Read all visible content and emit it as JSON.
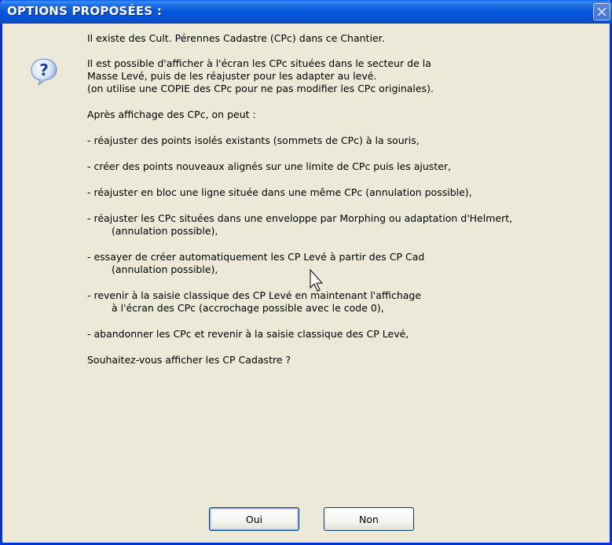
{
  "window": {
    "title": "OPTIONS PROPOSÉES :"
  },
  "icons": {
    "dialog_icon": "question-icon",
    "close": "close-icon",
    "pointer": "mouse-cursor-icon"
  },
  "message": {
    "lines": [
      "Il existe des Cult. Pérennes Cadastre (CPc) dans ce Chantier.",
      "Il est possible d'afficher à l'écran les CPc situées dans le secteur de la",
      "Masse Levé, puis de les réajuster pour les adapter au levé.",
      "(on utilise une COPIE des CPc pour ne pas modifier les CPc originales).",
      "Après affichage des CPc, on peut :",
      "- réajuster des points isolés existants (sommets de CPc) à la souris,",
      "- créer des points nouveaux alignés sur une limite de CPc puis les ajuster,",
      "- réajuster en bloc une ligne située dans une même CPc (annulation possible),",
      "- réajuster les CPc situées dans une enveloppe par Morphing ou adaptation d'Helmert,",
      "(annulation possible),",
      "- essayer de créer automatiquement les CP Levé à partir des CP Cad",
      "(annulation possible),",
      "- revenir à la saisie classique des CP Levé en maintenant l'affichage",
      "à l'écran des CPc (accrochage possible avec le code 0),",
      "- abandonner les CPc et revenir à la saisie classique des CP Levé,",
      "Souhaitez-vous afficher les CP Cadastre ?"
    ]
  },
  "buttons": {
    "yes": "Oui",
    "no": "Non"
  },
  "colors": {
    "titlebar": "#0656db",
    "dialog_bg": "#ece9d8",
    "frame": "#0831d9",
    "button_border": "#003c74"
  }
}
